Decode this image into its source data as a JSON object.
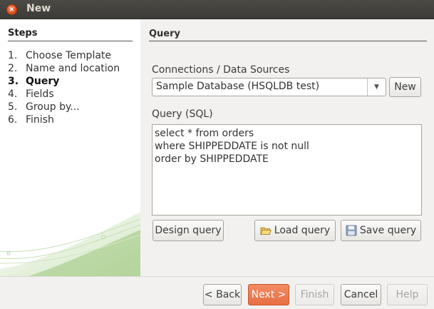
{
  "window": {
    "title": "New",
    "close_glyph": "×"
  },
  "steps": {
    "heading": "Steps",
    "items": [
      {
        "num": "1.",
        "label": "Choose Template"
      },
      {
        "num": "2.",
        "label": "Name and location"
      },
      {
        "num": "3.",
        "label": "Query",
        "active": true
      },
      {
        "num": "4.",
        "label": "Fields"
      },
      {
        "num": "5.",
        "label": "Group by..."
      },
      {
        "num": "6.",
        "label": "Finish"
      }
    ]
  },
  "query": {
    "section_title": "Query",
    "connections_label": "Connections / Data Sources",
    "connection_value": "Sample Database (HSQLDB test)",
    "new_button": "New",
    "sql_label": "Query (SQL)",
    "sql_lines": [
      "select * from orders",
      "where SHIPPEDDATE is not null",
      "order by SHIPPEDDATE"
    ],
    "design_button": "Design query",
    "load_button": "Load query",
    "save_button": "Save query"
  },
  "footer": {
    "back_button": "< Back",
    "next_button": "Next >",
    "finish_button": "Finish",
    "cancel_button": "Cancel",
    "help_button": "Help"
  },
  "colors": {
    "accent": "#e9734a",
    "titlebar": "#3c3b37",
    "close": "#df4b16"
  },
  "icons": [
    "close-icon",
    "chevron-down-icon",
    "folder-open-icon",
    "save-icon"
  ]
}
